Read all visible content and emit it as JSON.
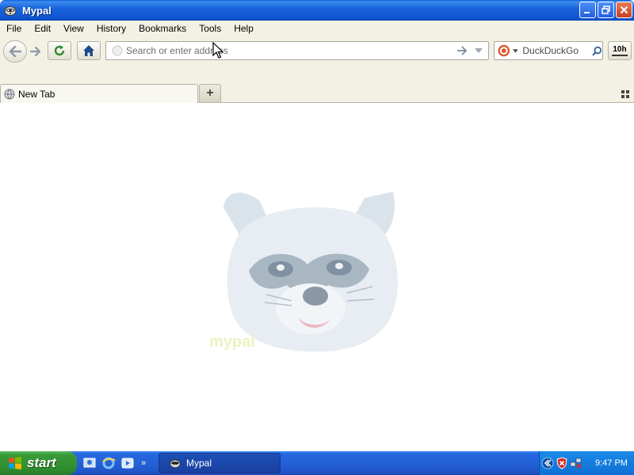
{
  "window": {
    "title": "Mypal"
  },
  "menubar": {
    "items": [
      "File",
      "Edit",
      "View",
      "History",
      "Bookmarks",
      "Tools",
      "Help"
    ]
  },
  "navbar": {
    "url_placeholder": "Search or enter address",
    "search_engine": "DuckDuckGo",
    "search_placeholder": "DuckDuckGo",
    "right_button_label": "10h"
  },
  "tabs": [
    {
      "label": "New Tab",
      "active": true
    }
  ],
  "content": {
    "mascot_caption": "mypal"
  },
  "taskbar": {
    "start_label": "start",
    "task_label": "Mypal",
    "clock": "9:47 PM"
  },
  "colors": {
    "titlebar": "#1a64dc",
    "chrome": "#f3f1e4",
    "taskbar": "#2561d6",
    "start": "#3a9a3a"
  }
}
